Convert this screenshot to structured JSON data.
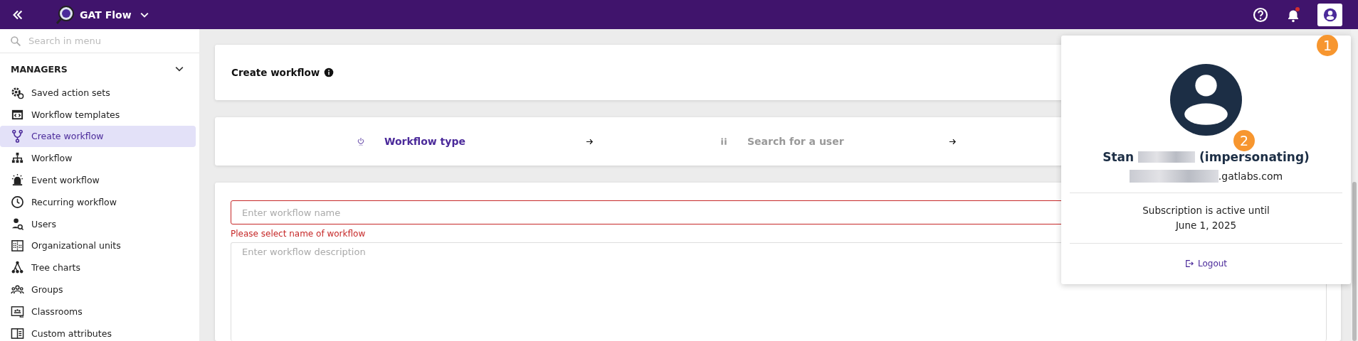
{
  "header": {
    "app_name": "GAT Flow"
  },
  "sidebar": {
    "search": {
      "placeholder": "Search in menu"
    },
    "section": "MANAGERS",
    "expanded": true,
    "items": [
      {
        "label": "Saved action sets",
        "selected": false
      },
      {
        "label": "Workflow templates",
        "selected": false
      },
      {
        "label": "Create workflow",
        "selected": true
      },
      {
        "label": "Workflow",
        "selected": false
      },
      {
        "label": "Event workflow",
        "selected": false
      },
      {
        "label": "Recurring workflow",
        "selected": false
      },
      {
        "label": "Users",
        "selected": false
      },
      {
        "label": "Organizational units",
        "selected": false
      },
      {
        "label": "Tree charts",
        "selected": false
      },
      {
        "label": "Groups",
        "selected": false
      },
      {
        "label": "Classrooms",
        "selected": false
      },
      {
        "label": "Custom attributes",
        "selected": false
      }
    ]
  },
  "page": {
    "title": "Create workflow",
    "steps": [
      {
        "label": "Workflow type",
        "selected": true
      },
      {
        "label": "Search for a user",
        "selected": false
      }
    ],
    "name_field": {
      "placeholder": "Enter workflow name",
      "error": "Please select name of workflow"
    },
    "description_field": {
      "placeholder": "Enter workflow description"
    }
  },
  "user_popup": {
    "first_name": "Stan",
    "suffix": "(impersonating)",
    "email_domain": ".gatlabs.com",
    "subscription": "Subscription is active until",
    "subscription_date": "June 1, 2025",
    "logout": "Logout"
  },
  "callouts": [
    "1",
    "2"
  ]
}
